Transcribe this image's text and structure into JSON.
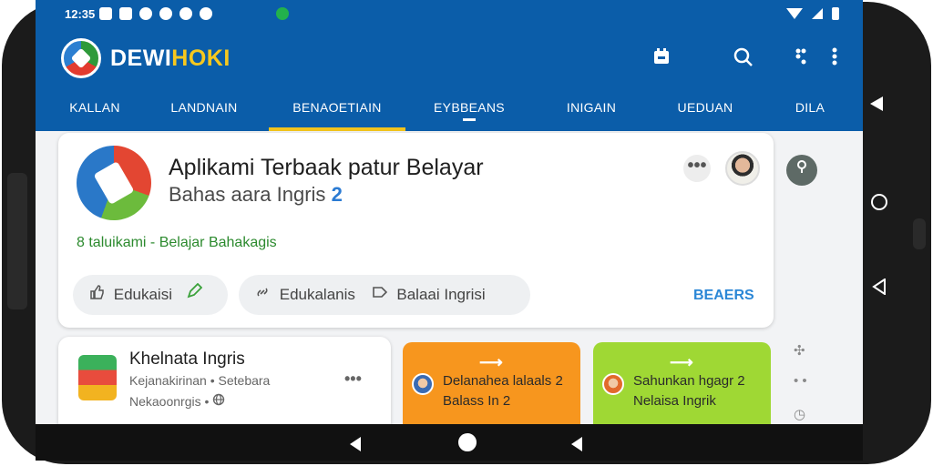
{
  "status_bar": {
    "time": "12:35"
  },
  "app_bar": {
    "brand_part1": "DEWI",
    "brand_part2": "HOKI",
    "icons": [
      "calendar-icon",
      "search-icon",
      "apps-icon",
      "more-vert-icon"
    ]
  },
  "tabs": [
    {
      "label": "KALLAN"
    },
    {
      "label": "LANDNAIN"
    },
    {
      "label": "BENAOETIAIN",
      "selected": true
    },
    {
      "label": "EYBBEANS"
    },
    {
      "label": "INIGAIN"
    },
    {
      "label": "UEDUAN"
    },
    {
      "label": "DILA"
    }
  ],
  "hero": {
    "title": "Aplikami Terbaak patur Belayar",
    "subtitle": "Bahas aara Ingris",
    "subtitle_badge": "2",
    "meta": "8 taluikami  -  Belajar Bahakagis",
    "chips": [
      {
        "label": "Edukaisi",
        "icon": "thumbs-up-icon"
      },
      {
        "label": "Edukalanis",
        "icon": "link-icon"
      },
      {
        "label": "Balaai Ingrisi",
        "icon": "tag-icon"
      }
    ],
    "link": "BEAERS",
    "more": "•••"
  },
  "row_card": {
    "title": "Khelnata Ingris",
    "line1": "Kejanakirinan • Setebara",
    "line2": "Nekaoonrgis •"
  },
  "promos": [
    {
      "title": "Delanahea lalaals",
      "title_badge": "2",
      "sub": "Balass In",
      "sub_badge": "2",
      "color": "#f7961e"
    },
    {
      "title": "Sahunkan hgagr",
      "title_badge": "2",
      "sub": "Nelaisa Ingrik",
      "color": "#9fd834"
    }
  ],
  "colors": {
    "primary": "#0b5da9",
    "accent": "#f2c31c",
    "link": "#2b87d6",
    "meta_green": "#2c8a2e"
  }
}
